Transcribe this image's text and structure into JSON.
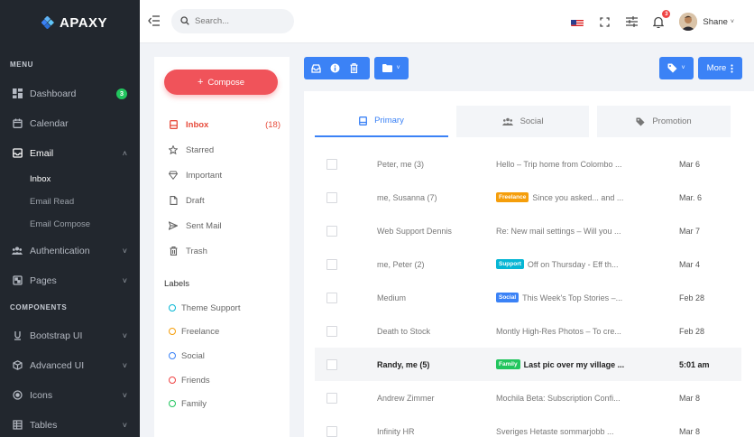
{
  "app": {
    "brand": "APAXY"
  },
  "sidebar": {
    "menu_title": "MENU",
    "components_title": "COMPONENTS",
    "items": [
      {
        "label": "Dashboard",
        "badge": "3"
      },
      {
        "label": "Calendar"
      },
      {
        "label": "Email"
      },
      {
        "label": "Authentication"
      },
      {
        "label": "Pages"
      },
      {
        "label": "Bootstrap UI"
      },
      {
        "label": "Advanced UI"
      },
      {
        "label": "Icons"
      },
      {
        "label": "Tables"
      }
    ],
    "email_sub": [
      "Inbox",
      "Email Read",
      "Email Compose"
    ]
  },
  "topbar": {
    "search_placeholder": "Search...",
    "notification_count": "3",
    "user_name": "Shane"
  },
  "mail_nav": {
    "compose_label": "Compose",
    "folders": [
      {
        "label": "Inbox",
        "count": "(18)"
      },
      {
        "label": "Starred"
      },
      {
        "label": "Important"
      },
      {
        "label": "Draft"
      },
      {
        "label": "Sent Mail"
      },
      {
        "label": "Trash"
      }
    ],
    "labels_title": "Labels",
    "labels": [
      {
        "label": "Theme Support",
        "color": "#06b6d4"
      },
      {
        "label": "Freelance",
        "color": "#f59e0b"
      },
      {
        "label": "Social",
        "color": "#3b82f6"
      },
      {
        "label": "Friends",
        "color": "#ef4444"
      },
      {
        "label": "Family",
        "color": "#22c55e"
      }
    ]
  },
  "toolbar": {
    "more_label": "More"
  },
  "tabs": [
    {
      "label": "Primary"
    },
    {
      "label": "Social"
    },
    {
      "label": "Promotion"
    }
  ],
  "emails": [
    {
      "from": "Peter, me (3)",
      "tag": "",
      "subject": "Hello – Trip home from Colombo ...",
      "date": "Mar 6"
    },
    {
      "from": "me, Susanna (7)",
      "tag": "Freelance",
      "tag_color": "#f59e0b",
      "subject": "Since you asked... and ...",
      "date": "Mar. 6"
    },
    {
      "from": "Web Support Dennis",
      "tag": "",
      "subject": "Re: New mail settings – Will you ...",
      "date": "Mar 7"
    },
    {
      "from": "me, Peter (2)",
      "tag": "Support",
      "tag_color": "#06b6d4",
      "subject": "Off on Thursday - Eff th...",
      "date": "Mar 4"
    },
    {
      "from": "Medium",
      "tag": "Social",
      "tag_color": "#3b82f6",
      "subject": "This Week's Top Stories –...",
      "date": "Feb 28"
    },
    {
      "from": "Death to Stock",
      "tag": "",
      "subject": "Montly High-Res Photos – To cre...",
      "date": "Feb 28"
    },
    {
      "from": "Randy, me (5)",
      "tag": "Family",
      "tag_color": "#22c55e",
      "subject": "Last pic over my village ...",
      "date": "5:01 am"
    },
    {
      "from": "Andrew Zimmer",
      "tag": "",
      "subject": "Mochila Beta: Subscription Confi...",
      "date": "Mar 8"
    },
    {
      "from": "Infinity HR",
      "tag": "",
      "subject": "Sveriges Hetaste sommarjobb ...",
      "date": "Mar 8"
    }
  ]
}
